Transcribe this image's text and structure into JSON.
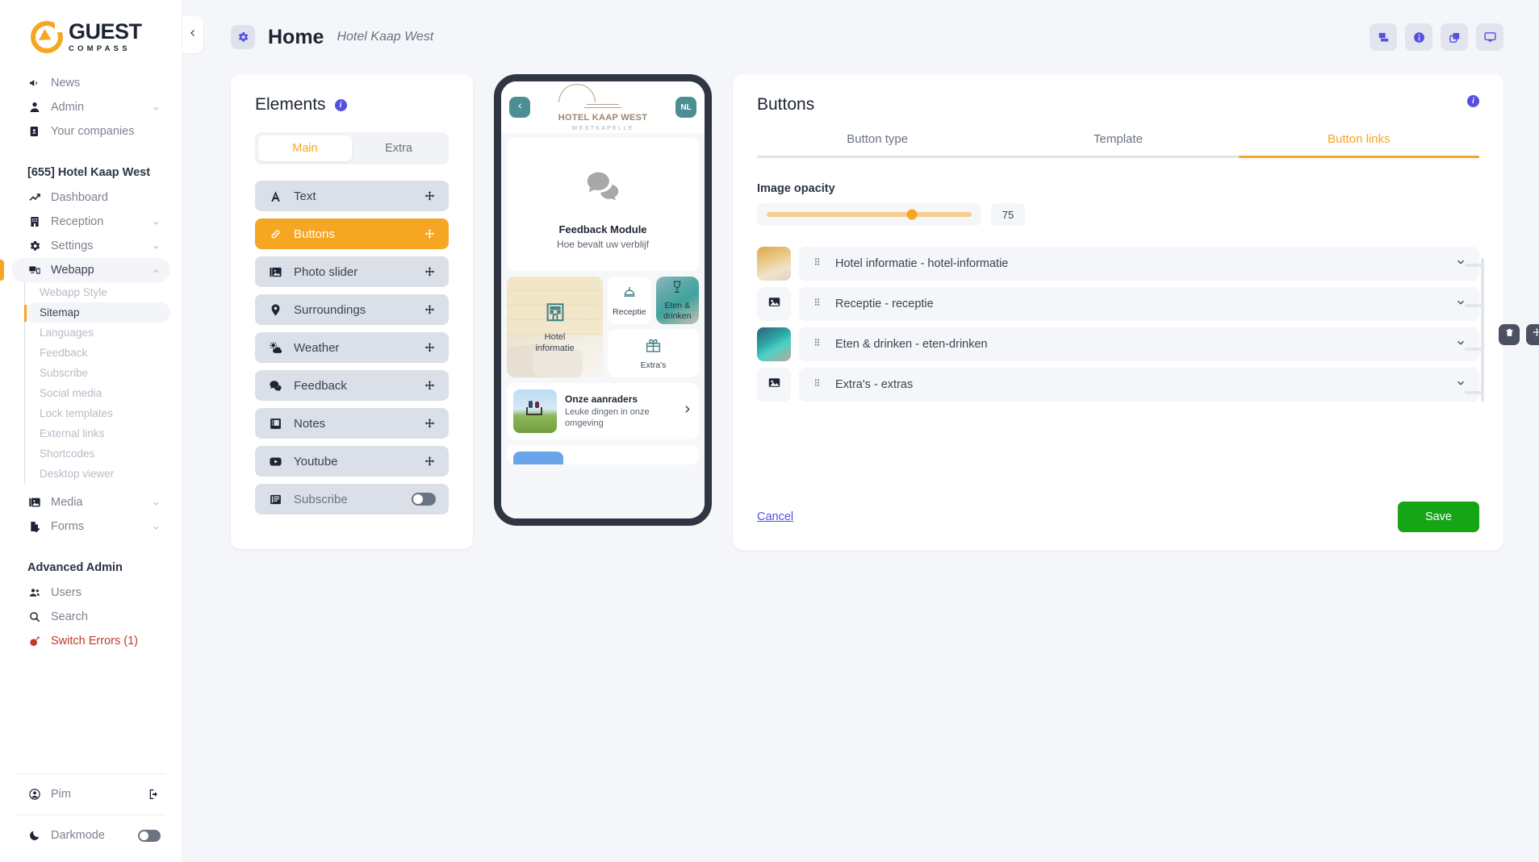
{
  "brand": {
    "name": "GUEST",
    "tagline": "COMPASS",
    "accent": "#f5a623"
  },
  "sidebar": {
    "top_items": [
      {
        "label": "News",
        "icon": "megaphone-icon",
        "chevron": false
      },
      {
        "label": "Admin",
        "icon": "admin-user-icon",
        "chevron": true
      },
      {
        "label": "Your companies",
        "icon": "companies-icon",
        "chevron": false
      }
    ],
    "section_title": "[655] Hotel Kaap West",
    "property_items": [
      {
        "label": "Dashboard",
        "icon": "chart-line-icon",
        "chevron": false
      },
      {
        "label": "Reception",
        "icon": "building-icon",
        "chevron": true
      },
      {
        "label": "Settings",
        "icon": "gear-icon",
        "chevron": true
      },
      {
        "label": "Webapp",
        "icon": "devices-icon",
        "chevron": true,
        "expanded": true
      }
    ],
    "webapp_subitems": [
      {
        "label": "Webapp Style",
        "active": false
      },
      {
        "label": "Sitemap",
        "active": true
      },
      {
        "label": "Languages",
        "active": false
      },
      {
        "label": "Feedback",
        "active": false
      },
      {
        "label": "Subscribe",
        "active": false
      },
      {
        "label": "Social media",
        "active": false
      },
      {
        "label": "Lock templates",
        "active": false
      },
      {
        "label": "External links",
        "active": false
      },
      {
        "label": "Shortcodes",
        "active": false
      },
      {
        "label": "Desktop viewer",
        "active": false
      }
    ],
    "after_items": [
      {
        "label": "Media",
        "icon": "media-icon",
        "chevron": true
      },
      {
        "label": "Forms",
        "icon": "form-icon",
        "chevron": true
      }
    ],
    "advanced_title": "Advanced Admin",
    "advanced_items": [
      {
        "label": "Users",
        "icon": "users-icon"
      },
      {
        "label": "Search",
        "icon": "search-icon"
      },
      {
        "label": "Switch Errors (1)",
        "icon": "bomb-icon",
        "danger": true
      }
    ],
    "user": {
      "label": "Pim",
      "icon": "account-circle-icon",
      "logout_icon": "logout-icon"
    },
    "darkmode": {
      "label": "Darkmode",
      "icon": "moon-icon",
      "enabled": false
    }
  },
  "header": {
    "gear_icon": "gear-icon",
    "title": "Home",
    "subtitle": "Hotel Kaap West",
    "actions": [
      {
        "icon": "pages-icon",
        "name": "page-overview-button"
      },
      {
        "icon": "info-circle-icon",
        "name": "info-button"
      },
      {
        "icon": "copy-icon",
        "name": "duplicate-button"
      },
      {
        "icon": "monitor-icon",
        "name": "desktop-preview-button"
      }
    ],
    "collapse_icon": "chevron-left-icon"
  },
  "elements": {
    "title": "Elements",
    "info_icon": "info-circle-icon",
    "tabs": [
      {
        "label": "Main",
        "active": true
      },
      {
        "label": "Extra",
        "active": false
      }
    ],
    "items": [
      {
        "label": "Text",
        "icon": "text-a-icon",
        "selected": false,
        "control": "drag"
      },
      {
        "label": "Buttons",
        "icon": "link-chain-icon",
        "selected": true,
        "control": "drag"
      },
      {
        "label": "Photo slider",
        "icon": "images-icon",
        "selected": false,
        "control": "drag"
      },
      {
        "label": "Surroundings",
        "icon": "map-pin-icon",
        "selected": false,
        "control": "drag"
      },
      {
        "label": "Weather",
        "icon": "weather-cloud-sun-icon",
        "selected": false,
        "control": "drag"
      },
      {
        "label": "Feedback",
        "icon": "chat-bubbles-icon",
        "selected": false,
        "control": "drag"
      },
      {
        "label": "Notes",
        "icon": "notes-icon",
        "selected": false,
        "control": "drag"
      },
      {
        "label": "Youtube",
        "icon": "youtube-icon",
        "selected": false,
        "control": "drag"
      },
      {
        "label": "Subscribe",
        "icon": "subscribe-icon",
        "selected": false,
        "control": "toggle",
        "toggle_on": false
      }
    ]
  },
  "phone": {
    "back_icon": "chevron-left-icon",
    "language": "NL",
    "logo": {
      "name": "HOTEL KAAP WEST",
      "subtitle": "WESTKAPELLE"
    },
    "feedback": {
      "icon": "chat-bubbles-icon",
      "title": "Feedback Module",
      "subtitle": "Hoe bevalt uw verblijf"
    },
    "tiles": [
      {
        "label": "Hotel\ninformatie",
        "icon": "hotel-building-icon",
        "style": "photo"
      },
      {
        "label": "Receptie",
        "icon": "reception-bell-icon",
        "style": "white"
      },
      {
        "label": "Eten &\ndrinken",
        "icon": "wine-glass-icon",
        "style": "photo"
      },
      {
        "label": "Extra's",
        "icon": "gift-icon",
        "style": "white"
      }
    ],
    "recommendation": {
      "title": "Onze aanraders",
      "subtitle": "Leuke dingen in onze omgeving",
      "chevron_icon": "chevron-right-icon"
    }
  },
  "panel": {
    "title": "Buttons",
    "info_icon": "info-circle-icon",
    "tabs": [
      {
        "label": "Button type",
        "active": false
      },
      {
        "label": "Template",
        "active": false
      },
      {
        "label": "Button links",
        "active": true
      }
    ],
    "opacity": {
      "label": "Image opacity",
      "value": "75",
      "min": "0",
      "max": "100"
    },
    "links": [
      {
        "label": "Hotel informatie - hotel-informatie",
        "thumb": "photo",
        "grip_icon": "grip-dots-icon",
        "chevron_icon": "chevron-down-icon"
      },
      {
        "label": "Receptie - receptie",
        "thumb": "placeholder",
        "grip_icon": "grip-dots-icon",
        "chevron_icon": "chevron-down-icon"
      },
      {
        "label": "Eten & drinken - eten-drinken",
        "thumb": "photo",
        "grip_icon": "grip-dots-icon",
        "chevron_icon": "chevron-down-icon"
      },
      {
        "label": "Extra's - extras",
        "thumb": "placeholder",
        "grip_icon": "grip-dots-icon",
        "chevron_icon": "chevron-down-icon"
      }
    ],
    "group_actions": [
      {
        "icon": "trash-icon",
        "name": "delete-group-button"
      },
      {
        "icon": "move-arrows-icon",
        "name": "move-group-button"
      }
    ],
    "cancel_label": "Cancel",
    "save_label": "Save",
    "save_color": "#16a516"
  }
}
